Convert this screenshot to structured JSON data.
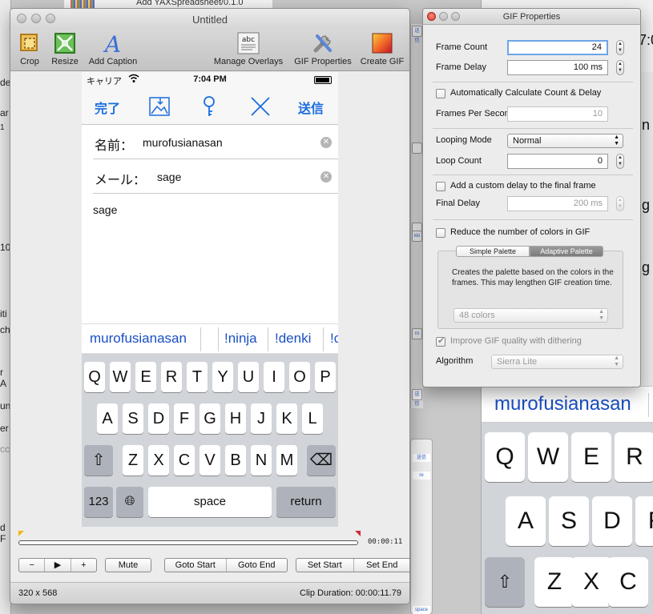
{
  "background": {
    "left_fragments": [
      "de",
      "ar",
      "1",
      "10",
      "iti",
      "ch",
      "r A",
      "un",
      "er",
      "ccro",
      "d F"
    ],
    "top_strip_text": "Add YAXSpreadsheet/0.1.0",
    "right_fragments": [
      "7:0",
      "n",
      "g",
      "g"
    ],
    "right_suggestion": "murofusianasan",
    "right_keys": [
      "Q",
      "W",
      "E",
      "R",
      "T",
      "A",
      "S",
      "D",
      "F",
      "Z",
      "X",
      "C"
    ],
    "chip_texts": [
      "送信",
      "kki",
      "ro",
      "送信",
      "re",
      "送信",
      "space",
      "return",
      "tum"
    ]
  },
  "main_window": {
    "title": "Untitled",
    "toolbar": [
      {
        "label": "Crop",
        "icon": "crop-icon"
      },
      {
        "label": "Resize",
        "icon": "resize-icon"
      },
      {
        "label": "Add Caption",
        "icon": "caption-icon"
      },
      {
        "label": "Manage Overlays",
        "icon": "overlays-icon"
      },
      {
        "label": "GIF Properties",
        "icon": "gif-properties-icon"
      },
      {
        "label": "Create GIF",
        "icon": "create-gif-icon"
      }
    ],
    "overlay_icon_text": "abc",
    "phone": {
      "carrier": "キャリア",
      "time": "7:04 PM",
      "nav_done": "完了",
      "nav_send": "送信",
      "name_label": "名前：",
      "name_value": "murofusianasan",
      "mail_label": "メール：",
      "mail_value": "sage",
      "body": "sage",
      "suggestions": [
        "murofusianasan",
        "!ninja",
        "!denki",
        "!c"
      ],
      "keys_row1": [
        "Q",
        "W",
        "E",
        "R",
        "T",
        "Y",
        "U",
        "I",
        "O",
        "P"
      ],
      "keys_row2": [
        "A",
        "S",
        "D",
        "F",
        "G",
        "H",
        "J",
        "K",
        "L"
      ],
      "keys_row3": [
        "Z",
        "X",
        "C",
        "V",
        "B",
        "N",
        "M"
      ],
      "key_123": "123",
      "key_space": "space",
      "key_return": "return"
    },
    "timeline_time": "00:00:11",
    "controls": {
      "minus": "−",
      "play": "▶",
      "plus": "+",
      "mute": "Mute",
      "goto_start": "Goto Start",
      "goto_end": "Goto End",
      "set_start": "Set Start",
      "set_end": "Set End"
    },
    "status_dimensions": "320 x 568",
    "status_clip": "Clip Duration: 00:00:11.79"
  },
  "gif_properties": {
    "title": "GIF Properties",
    "frame_count_label": "Frame Count",
    "frame_count_value": "24",
    "frame_delay_label": "Frame Delay",
    "frame_delay_value": "100 ms",
    "auto_calc_label": "Automatically Calculate Count & Delay",
    "fps_label": "Frames Per Second",
    "fps_value": "10",
    "looping_mode_label": "Looping Mode",
    "looping_mode_value": "Normal",
    "loop_count_label": "Loop Count",
    "loop_count_value": "0",
    "custom_delay_label": "Add a custom delay to the final frame",
    "final_delay_label": "Final Delay",
    "final_delay_value": "200 ms",
    "reduce_colors_label": "Reduce the number of colors in GIF",
    "tab_simple": "Simple Palette",
    "tab_adaptive": "Adaptive Palette",
    "palette_desc": "Creates the palette based on the colors in the frames.  This may lengthen GIF creation time.",
    "colors_value": "48 colors",
    "dithering_label": "Improve GIF quality with dithering",
    "algorithm_label": "Algorithm",
    "algorithm_value": "Sierra Lite"
  }
}
